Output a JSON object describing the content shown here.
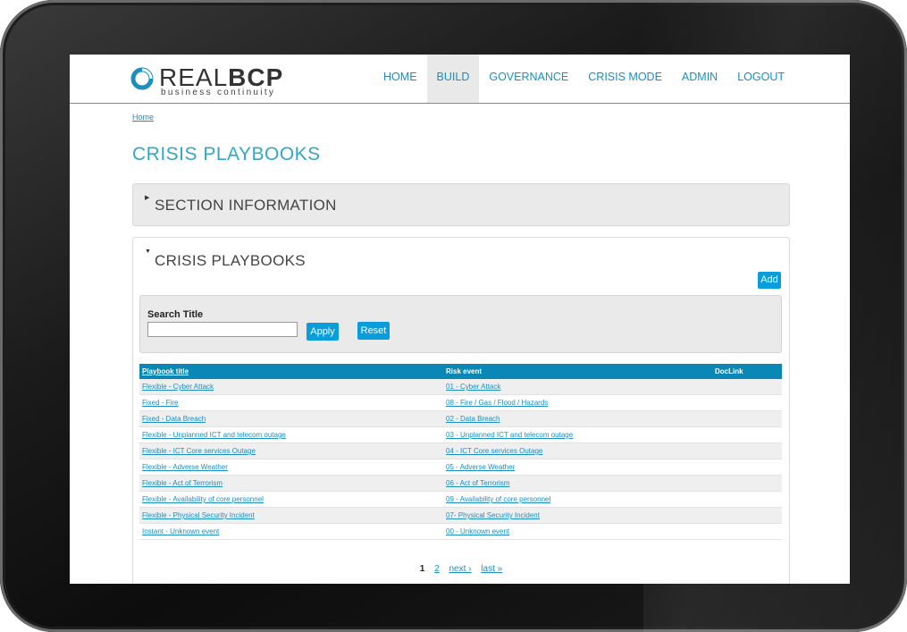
{
  "brand": {
    "name_light": "REAL",
    "name_bold": "BCP",
    "tagline": "business continuity",
    "accent_color": "#31a7c9",
    "button_color": "#0a9ddb"
  },
  "nav": {
    "items": [
      {
        "label": "HOME"
      },
      {
        "label": "BUILD",
        "active": true
      },
      {
        "label": "GOVERNANCE"
      },
      {
        "label": "CRISIS MODE"
      },
      {
        "label": "ADMIN"
      },
      {
        "label": "LOGOUT"
      }
    ]
  },
  "breadcrumb": "Home",
  "page_title": "CRISIS PLAYBOOKS",
  "section_info": {
    "title": "SECTION INFORMATION",
    "expanded": false
  },
  "playbooks_panel": {
    "title": "CRISIS PLAYBOOKS",
    "expanded": true,
    "add_label": "Add",
    "search": {
      "label": "Search Title",
      "value": "",
      "apply_label": "Apply",
      "reset_label": "Reset"
    },
    "table": {
      "headers": [
        "Playbook title",
        "Risk event",
        "DocLink"
      ],
      "rows": [
        {
          "title": "Flexible - Cyber Attack",
          "risk": "01 - Cyber Attack",
          "doclink": ""
        },
        {
          "title": "Fixed - Fire",
          "risk": "08 - Fire / Gas / Flood / Hazards",
          "doclink": ""
        },
        {
          "title": "Fixed - Data Breach",
          "risk": "02 - Data Breach",
          "doclink": ""
        },
        {
          "title": "Flexible - Unplanned ICT and telecom outage",
          "risk": "03 - Unplanned ICT and telecom outage",
          "doclink": ""
        },
        {
          "title": "Flexible - ICT Core services Outage",
          "risk": "04 - ICT Core services Outage",
          "doclink": ""
        },
        {
          "title": "Flexible - Adverse Weather",
          "risk": "05 - Adverse Weather",
          "doclink": ""
        },
        {
          "title": "Flexible - Act of Terrorism",
          "risk": "06 - Act of Terrorism",
          "doclink": ""
        },
        {
          "title": "Flexible - Availability of core personnel",
          "risk": "09 - Availability of core personnel",
          "doclink": ""
        },
        {
          "title": "Flexible - Physical Security Incident",
          "risk": "07- Physical Security Incident",
          "doclink": ""
        },
        {
          "title": "Instant - Unknown event",
          "risk": "00 - Unknown event",
          "doclink": ""
        }
      ]
    },
    "pager": {
      "current": "1",
      "page2": "2",
      "next": "next ›",
      "last": "last »"
    }
  }
}
